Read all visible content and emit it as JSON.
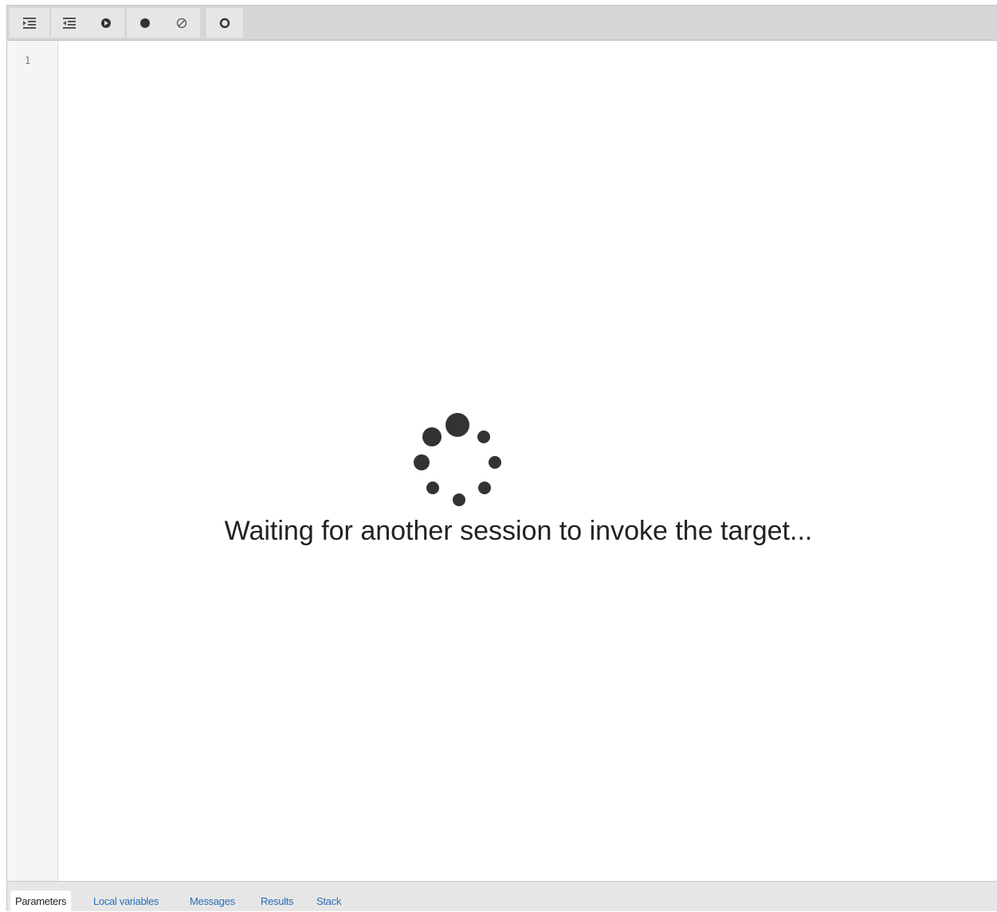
{
  "toolbar": {
    "buttons": [
      {
        "name": "step-into-button",
        "icon": "step-into-icon"
      },
      {
        "name": "step-over-button",
        "icon": "step-over-icon"
      },
      {
        "name": "continue-button",
        "icon": "continue-icon"
      },
      {
        "name": "toggle-breakpoint-button",
        "icon": "breakpoint-icon"
      },
      {
        "name": "clear-breakpoints-button",
        "icon": "clear-breakpoints-icon"
      },
      {
        "name": "stop-button",
        "icon": "stop-icon"
      }
    ]
  },
  "editor": {
    "line_numbers": [
      "1"
    ],
    "status_message": "Waiting for another session to invoke the target...",
    "spinner_icon": "loading-spinner-icon"
  },
  "tabs": [
    {
      "label": "Parameters",
      "active": true
    },
    {
      "label": "Local variables",
      "active": false
    },
    {
      "label": "Messages",
      "active": false
    },
    {
      "label": "Results",
      "active": false
    },
    {
      "label": "Stack",
      "active": false
    }
  ],
  "colors": {
    "toolbar_bg": "#d6d6d6",
    "tab_link": "#2a6fb8",
    "text": "#222222"
  }
}
